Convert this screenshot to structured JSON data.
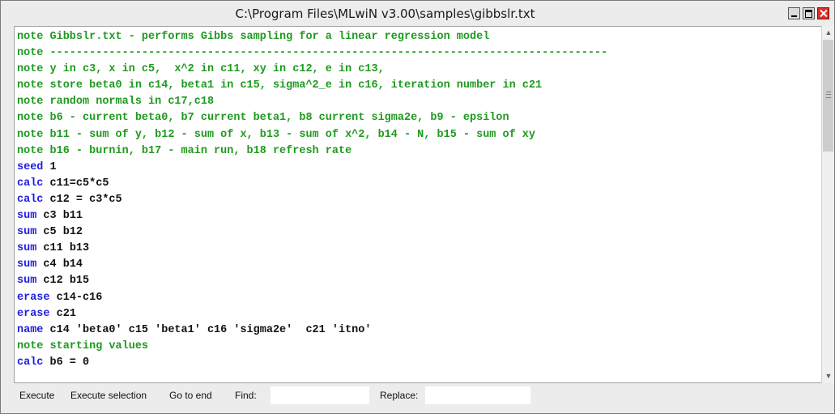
{
  "window": {
    "title": "C:\\Program Files\\MLwiN v3.00\\samples\\gibbslr.txt"
  },
  "colors": {
    "comment": "#1f9a1f",
    "keyword": "#1f1fe0",
    "text": "#111111",
    "close_button": "#d9302a"
  },
  "editor": {
    "lines": [
      {
        "kw": "note",
        "rest": " Gibbslr.txt - performs Gibbs sampling for a linear regression model",
        "is_note": true
      },
      {
        "kw": "note",
        "rest": " -------------------------------------------------------------------------------------",
        "is_note": true
      },
      {
        "kw": "note",
        "rest": " y in c3, x in c5,  x^2 in c11, xy in c12, e in c13,",
        "is_note": true
      },
      {
        "kw": "note",
        "rest": " store beta0 in c14, beta1 in c15, sigma^2_e in c16, iteration number in c21",
        "is_note": true
      },
      {
        "kw": "note",
        "rest": " random normals in c17,c18",
        "is_note": true
      },
      {
        "kw": "note",
        "rest": " b6 - current beta0, b7 current beta1, b8 current sigma2e, b9 - epsilon",
        "is_note": true
      },
      {
        "kw": "note",
        "rest": " b11 - sum of y, b12 - sum of x, b13 - sum of x^2, b14 - N, b15 - sum of xy",
        "is_note": true
      },
      {
        "kw": "note",
        "rest": " b16 - burnin, b17 - main run, b18 refresh rate",
        "is_note": true
      },
      {
        "kw": "seed",
        "rest": " 1",
        "is_note": false
      },
      {
        "kw": "calc",
        "rest": " c11=c5*c5",
        "is_note": false
      },
      {
        "kw": "calc",
        "rest": " c12 = c3*c5",
        "is_note": false
      },
      {
        "kw": "sum",
        "rest": " c3 b11",
        "is_note": false
      },
      {
        "kw": "sum",
        "rest": " c5 b12",
        "is_note": false
      },
      {
        "kw": "sum",
        "rest": " c11 b13",
        "is_note": false
      },
      {
        "kw": "sum",
        "rest": " c4 b14",
        "is_note": false
      },
      {
        "kw": "sum",
        "rest": " c12 b15",
        "is_note": false
      },
      {
        "kw": "erase",
        "rest": " c14-c16",
        "is_note": false
      },
      {
        "kw": "erase",
        "rest": " c21",
        "is_note": false
      },
      {
        "kw": "name",
        "rest": " c14 'beta0' c15 'beta1' c16 'sigma2e'  c21 'itno'",
        "is_note": false
      },
      {
        "kw": "note",
        "rest": " starting values",
        "is_note": true
      },
      {
        "kw": "calc",
        "rest": " b6 = 0",
        "is_note": false
      }
    ]
  },
  "scrollbar": {
    "up_icon": "triangle-up-icon",
    "down_icon": "triangle-down-icon"
  },
  "bottombar": {
    "execute_label": "Execute",
    "execute_selection_label": "Execute selection",
    "go_to_end_label": "Go to end",
    "find_label": "Find:",
    "find_value": "",
    "replace_label": "Replace:",
    "replace_value": ""
  }
}
